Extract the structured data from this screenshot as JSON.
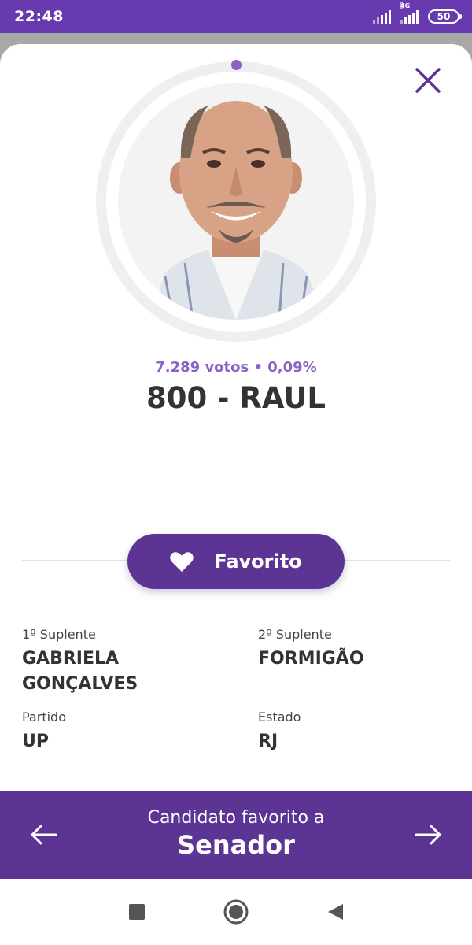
{
  "status_bar": {
    "time": "22:48",
    "network_type": "4G",
    "battery": "50"
  },
  "candidate": {
    "votes_line": "7.289 votos • 0,09%",
    "name_line": "800 - RAUL"
  },
  "favorite_button": {
    "label": "Favorito"
  },
  "details": {
    "first_substitute_label": "1º Suplente",
    "first_substitute_value_line1": "GABRIELA",
    "first_substitute_value_line2": "GONÇALVES",
    "second_substitute_label": "2º Suplente",
    "second_substitute_value": "FORMIGÃO",
    "party_label": "Partido",
    "party_value": "UP",
    "state_label": "Estado",
    "state_value": "RJ"
  },
  "bottom_bar": {
    "subtitle": "Candidato favorito a",
    "title": "Senador"
  },
  "colors": {
    "brand": "#673ab0",
    "button": "#5c3594",
    "accent_text": "#8a63c4"
  },
  "icons": [
    "signal-icon",
    "close-icon",
    "heart-icon",
    "arrow-left-icon",
    "arrow-right-icon",
    "nav-square-icon",
    "nav-circle-icon",
    "nav-back-icon"
  ]
}
